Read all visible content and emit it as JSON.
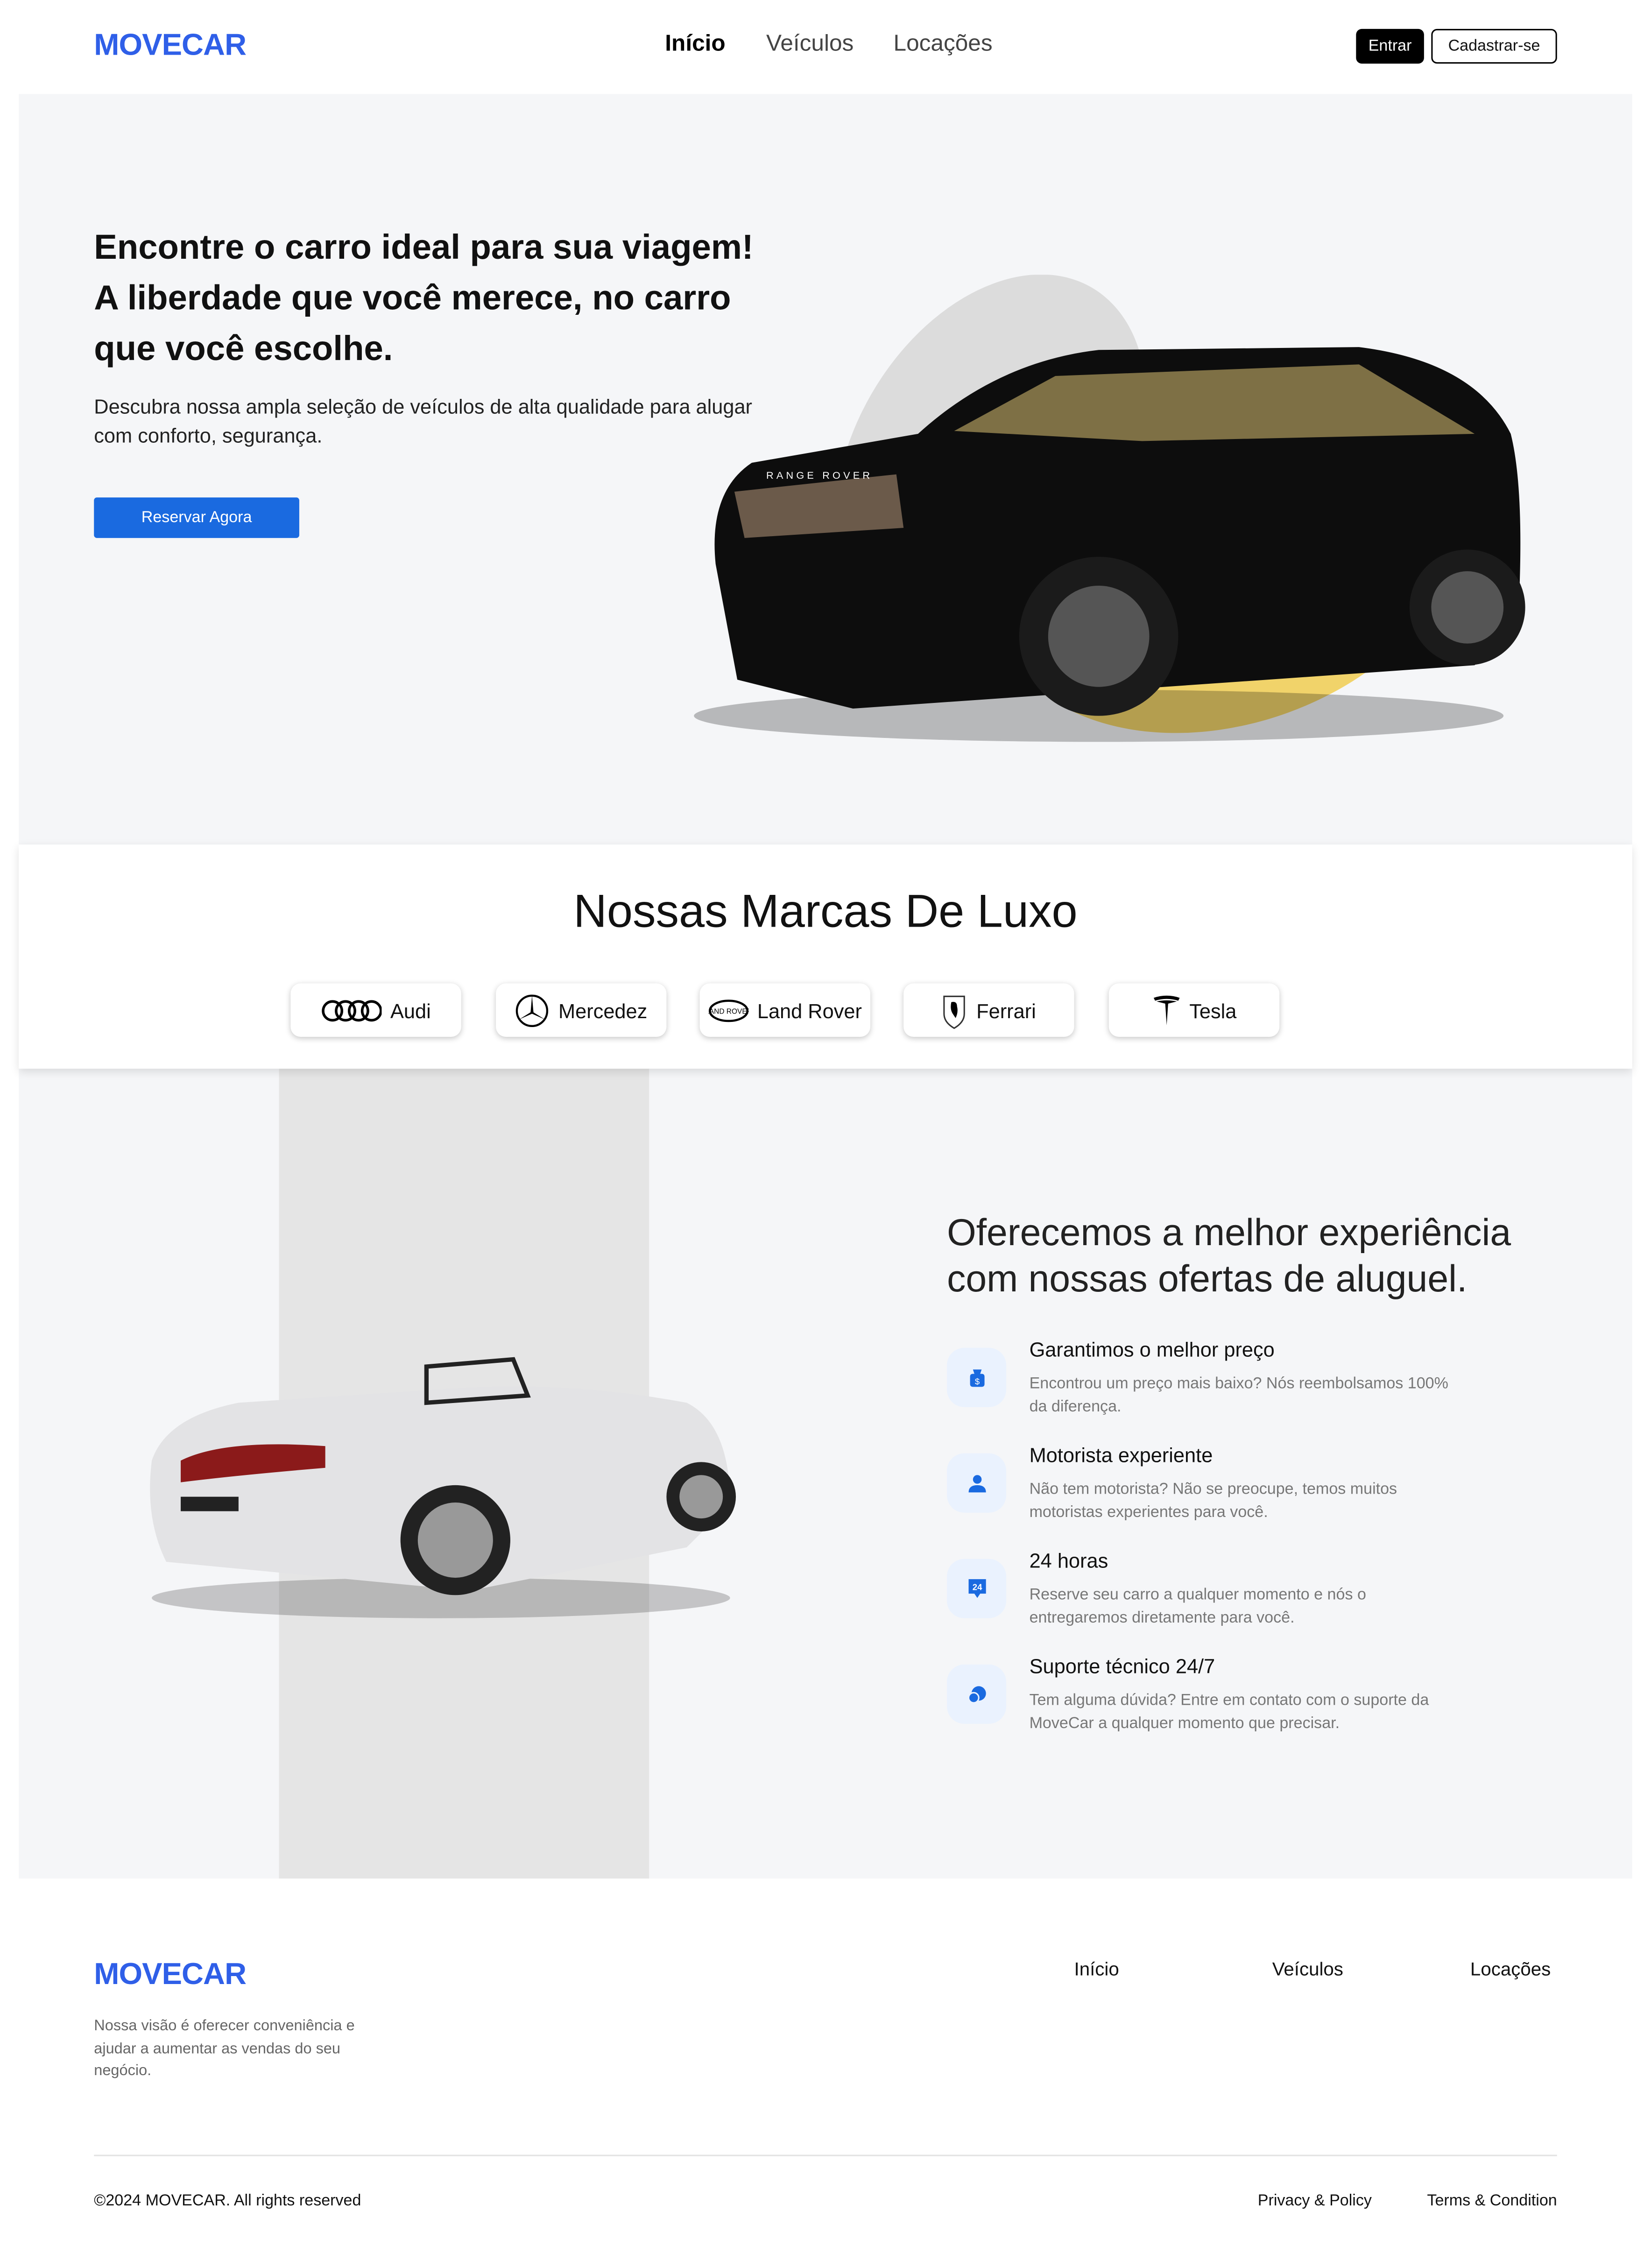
{
  "header": {
    "logo": "MOVECAR",
    "nav": [
      "Início",
      "Veículos",
      "Locações"
    ],
    "login": "Entrar",
    "signup": "Cadastrar-se"
  },
  "hero": {
    "title_lines": [
      "Encontre o carro ideal para sua viagem!",
      "A liberdade que você merece, no carro",
      "que você escolhe."
    ],
    "subtitle": "Descubra nossa ampla seleção de veículos de alta qualidade para alugar com conforto, segurança.",
    "cta": "Reservar Agora",
    "car_badge": "RANGE ROVER"
  },
  "brands": {
    "title": "Nossas Marcas De Luxo",
    "items": [
      {
        "name": "Audi",
        "icon": "audi-rings-icon"
      },
      {
        "name": "Mercedez",
        "icon": "mercedes-star-icon"
      },
      {
        "name": "Land Rover",
        "icon": "land-rover-badge-icon"
      },
      {
        "name": "Ferrari",
        "icon": "ferrari-horse-icon"
      },
      {
        "name": "Tesla",
        "icon": "tesla-t-icon"
      }
    ]
  },
  "features": {
    "title": "Oferecemos a melhor experiência com nossas ofertas de aluguel.",
    "items": [
      {
        "title": "Garantimos o melhor preço",
        "desc": "Encontrou um preço mais baixo? Nós reembolsamos 100% da diferença.",
        "icon": "money-bag-icon"
      },
      {
        "title": "Motorista experiente",
        "desc": "Não tem motorista? Não se preocupe, temos muitos motoristas experientes para você.",
        "icon": "verified-driver-icon"
      },
      {
        "title": "24 horas",
        "desc": "Reserve seu carro a qualquer momento e nós o entregaremos diretamente para você.",
        "icon": "24-hours-icon"
      },
      {
        "title": "Suporte técnico 24/7",
        "desc": "Tem alguma dúvida? Entre em contato com o suporte da MoveCar a qualquer momento que precisar.",
        "icon": "support-chat-icon"
      }
    ]
  },
  "footer": {
    "logo": "MOVECAR",
    "tagline": "Nossa visão é oferecer conveniência e ajudar a aumentar as vendas do seu negócio.",
    "links": [
      "Início",
      "Veículos",
      "Locações"
    ],
    "copyright": "©2024 MOVECAR. All rights reserved",
    "privacy": "Privacy & Policy",
    "terms": "Terms & Condition"
  },
  "colors": {
    "brand": "#2f5fe8",
    "cta": "#1a6ae0",
    "icon_bg": "#eaf2fe",
    "accent_yellow": "#f1d36a"
  }
}
